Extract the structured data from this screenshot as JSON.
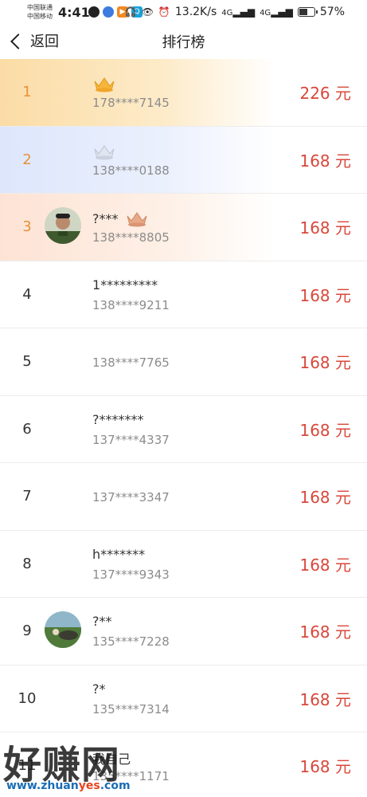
{
  "status_bar": {
    "carrier1": "中国联通",
    "carrier2": "中国移动",
    "time": "4:41",
    "speed": "13.2K/s",
    "signal1": "4G",
    "signal2": "4G",
    "battery": "57%",
    "battery_level": 0.57,
    "icons": [
      "qq-icon",
      "browser-icon",
      "video-app-icon",
      "search-app-icon",
      "headphones-icon",
      "eye-icon",
      "alarm-icon",
      "signal-icon",
      "signal-icon",
      "battery-icon"
    ]
  },
  "header": {
    "back_label": "返回",
    "title": "排行榜"
  },
  "rows": [
    {
      "rank": "1",
      "name": "",
      "phone": "178****7145",
      "amount": "226 元",
      "medal": "gold-crown-icon"
    },
    {
      "rank": "2",
      "name": "",
      "phone": "138****0188",
      "amount": "168 元",
      "medal": "silver-crown-icon"
    },
    {
      "rank": "3",
      "name": "?***",
      "phone": "138****8805",
      "amount": "168 元",
      "medal": "bronze-crown-icon",
      "avatar": "avatar-soldier"
    },
    {
      "rank": "4",
      "name": "1*********",
      "phone": "138****9211",
      "amount": "168 元"
    },
    {
      "rank": "5",
      "name": "",
      "phone": "138****7765",
      "amount": "168 元"
    },
    {
      "rank": "6",
      "name": "?*******",
      "phone": "137****4337",
      "amount": "168 元"
    },
    {
      "rank": "7",
      "name": "",
      "phone": "137****3347",
      "amount": "168 元"
    },
    {
      "rank": "8",
      "name": "h*******",
      "phone": "137****9343",
      "amount": "168 元"
    },
    {
      "rank": "9",
      "name": "?**",
      "phone": "135****7228",
      "amount": "168 元",
      "avatar": "avatar-landscape"
    },
    {
      "rank": "10",
      "name": "?*",
      "phone": "135****7314",
      "amount": "168 元"
    },
    {
      "rank": "11",
      "name": "我自己",
      "phone": "135****1171",
      "amount": "168 元"
    }
  ],
  "watermark": {
    "main": "好赚网",
    "url_prefix": "www.zhuan",
    "url_accent": "yes",
    "url_suffix": ".com"
  },
  "colors": {
    "amount": "#d9473a",
    "rank_top": "#e8913a",
    "gold_bg": "#fbdca6",
    "silver_bg": "#dde6fc",
    "bronze_bg": "#fde3d5"
  }
}
